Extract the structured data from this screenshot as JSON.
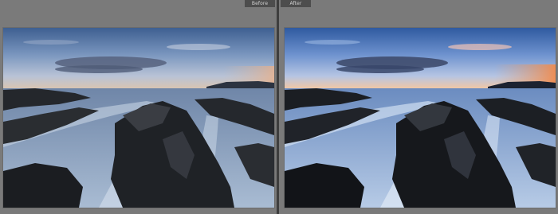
{
  "view": {
    "before_label": "Before",
    "after_label": "After"
  },
  "photos": {
    "before": {
      "subject": "seascape-rocks-long-exposure",
      "tone": "muted"
    },
    "after": {
      "subject": "seascape-rocks-long-exposure",
      "tone": "enhanced"
    }
  },
  "colors": {
    "panel_bg": "#7a7a7a",
    "label_bg": "#4d4d4d",
    "label_text": "#d2d2d2",
    "divider": "#3e3e3e"
  }
}
